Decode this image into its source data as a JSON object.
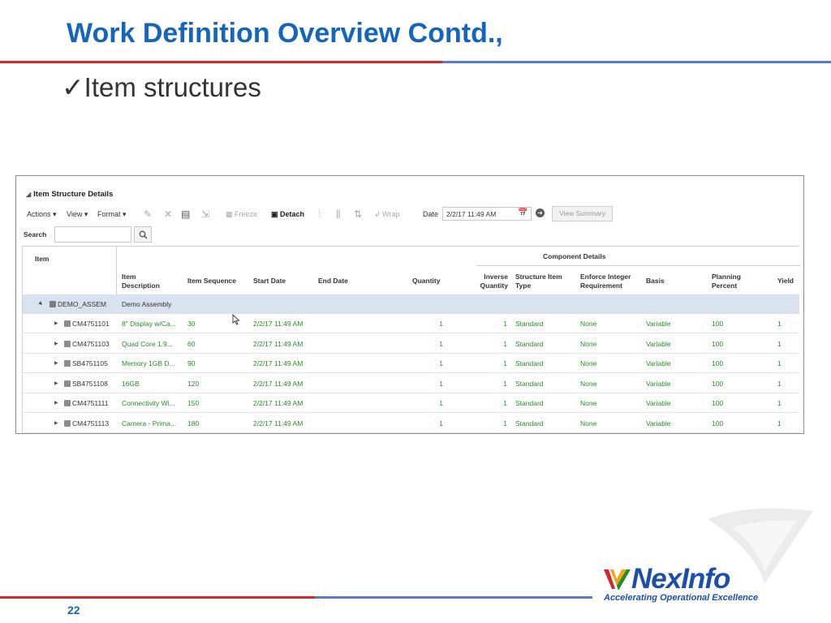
{
  "slide": {
    "title": "Work Definition Overview Contd.,",
    "bullet": "✓Item structures",
    "page_number": "22"
  },
  "panel": {
    "title": "Item Structure Details",
    "toolbar": {
      "actions": "Actions",
      "view": "View",
      "format": "Format",
      "freeze": "Freeze",
      "detach": "Detach",
      "wrap": "Wrap",
      "date_label": "Date",
      "date_value": "2/2/17 11:49 AM",
      "view_summary": "View Summary"
    },
    "search_label": "Search",
    "columns": {
      "item": "Item",
      "component_details": "Component Details",
      "item_description": [
        "Item",
        "Description"
      ],
      "item_sequence": "Item Sequence",
      "start_date": "Start Date",
      "end_date": "End Date",
      "quantity": "Quantity",
      "inverse_quantity": [
        "Inverse",
        "Quantity"
      ],
      "structure_item_type": [
        "Structure Item",
        "Type"
      ],
      "enforce_integer": [
        "Enforce Integer",
        "Requirement"
      ],
      "basis": "Basis",
      "planning_percent": [
        "Planning",
        "Percent"
      ],
      "yield": "Yield"
    },
    "parent": {
      "item": "DEMO_ASSEM",
      "description": "Demo Assembly"
    },
    "rows": [
      {
        "item": "CM4751101",
        "description": "8\" Display w/Ca...",
        "sequence": "30",
        "start_date": "2/2/17 11:49 AM",
        "end_date": "",
        "quantity": "1",
        "inverse_quantity": "1",
        "structure_type": "Standard",
        "enforce": "None",
        "basis": "Variable",
        "planning": "100",
        "yield": "1"
      },
      {
        "item": "CM4751103",
        "description": "Quad Core 1.9...",
        "sequence": "60",
        "start_date": "2/2/17 11:49 AM",
        "end_date": "",
        "quantity": "1",
        "inverse_quantity": "1",
        "structure_type": "Standard",
        "enforce": "None",
        "basis": "Variable",
        "planning": "100",
        "yield": "1"
      },
      {
        "item": "SB4751105",
        "description": "Memory 1GB D...",
        "sequence": "90",
        "start_date": "2/2/17 11:49 AM",
        "end_date": "",
        "quantity": "1",
        "inverse_quantity": "1",
        "structure_type": "Standard",
        "enforce": "None",
        "basis": "Variable",
        "planning": "100",
        "yield": "1"
      },
      {
        "item": "SB4751108",
        "description": "16GB",
        "sequence": "120",
        "start_date": "2/2/17 11:49 AM",
        "end_date": "",
        "quantity": "1",
        "inverse_quantity": "1",
        "structure_type": "Standard",
        "enforce": "None",
        "basis": "Variable",
        "planning": "100",
        "yield": "1"
      },
      {
        "item": "CM4751111",
        "description": "Connectivity Wi...",
        "sequence": "150",
        "start_date": "2/2/17 11:49 AM",
        "end_date": "",
        "quantity": "1",
        "inverse_quantity": "1",
        "structure_type": "Standard",
        "enforce": "None",
        "basis": "Variable",
        "planning": "100",
        "yield": "1"
      },
      {
        "item": "CM4751113",
        "description": "Camera - Prima...",
        "sequence": "180",
        "start_date": "2/2/17 11:49 AM",
        "end_date": "",
        "quantity": "1",
        "inverse_quantity": "1",
        "structure_type": "Standard",
        "enforce": "None",
        "basis": "Variable",
        "planning": "100",
        "yield": "1"
      }
    ]
  },
  "brand": {
    "logo": "NexInfo",
    "tagline": "Accelerating Operational Excellence"
  },
  "colors": {
    "title_blue": "#1565b8",
    "rule_red": "#d6262b",
    "rule_blue": "#5b79c8",
    "value_green": "#2a8a2a",
    "selected_row": "#d9e3ef"
  }
}
